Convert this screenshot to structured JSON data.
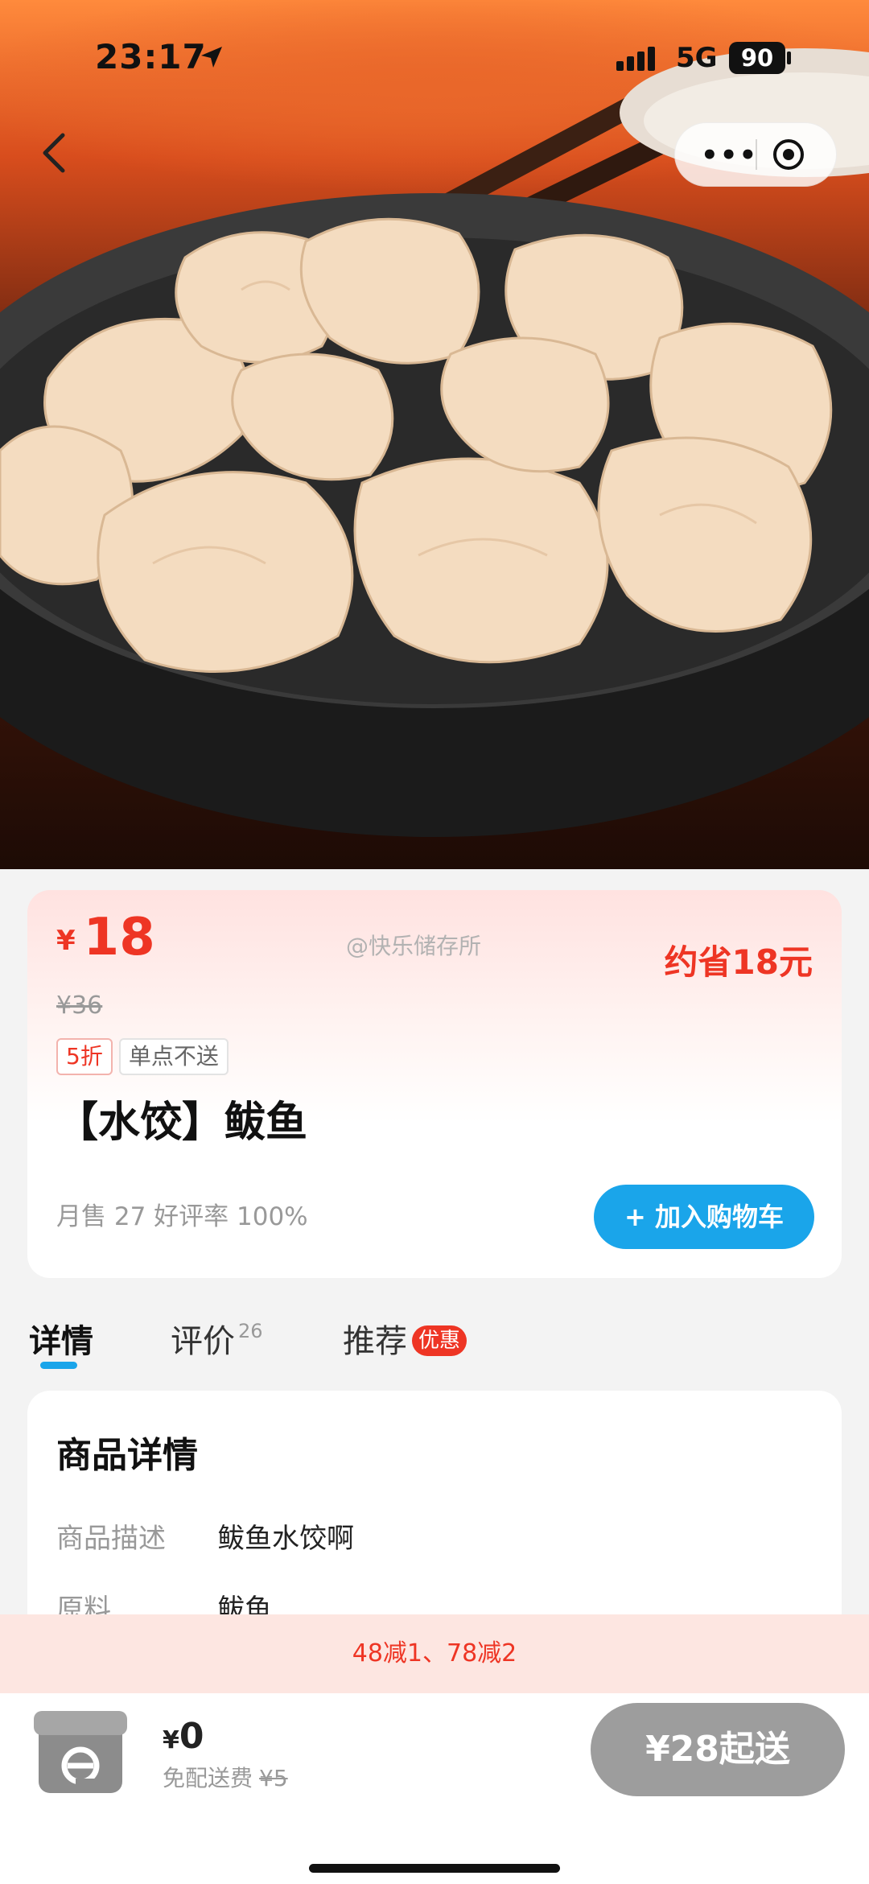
{
  "status_bar": {
    "time": "23:17",
    "network": "5G",
    "battery": "90"
  },
  "product": {
    "price_currency": "¥",
    "price": "18",
    "original_price": "¥36",
    "save_text": "约省18元",
    "watermark": "@快乐储存所",
    "tags": [
      "5折",
      "单点不送"
    ],
    "title": "【水饺】鲅鱼",
    "stats": "月售 27 好评率 100%",
    "add_cart_label": "+ 加入购物车"
  },
  "tabs": {
    "detail": "详情",
    "review": "评价",
    "review_count": "26",
    "recommend": "推荐",
    "recommend_badge": "优惠"
  },
  "details": {
    "heading": "商品详情",
    "rows": [
      {
        "label": "商品描述",
        "value": "鲅鱼水饺啊"
      },
      {
        "label": "原料",
        "value": "鲅鱼"
      }
    ]
  },
  "promo_banner": "48减1、78减2",
  "bottom_bar": {
    "currency": "¥",
    "delivery_amount": "0",
    "delivery_label": "免配送费",
    "delivery_original": "¥5",
    "min_order_label": "¥28起送"
  },
  "colors": {
    "accent_red": "#ee3524",
    "accent_blue": "#1aa5ea",
    "disabled_gray": "#9d9d9d"
  }
}
